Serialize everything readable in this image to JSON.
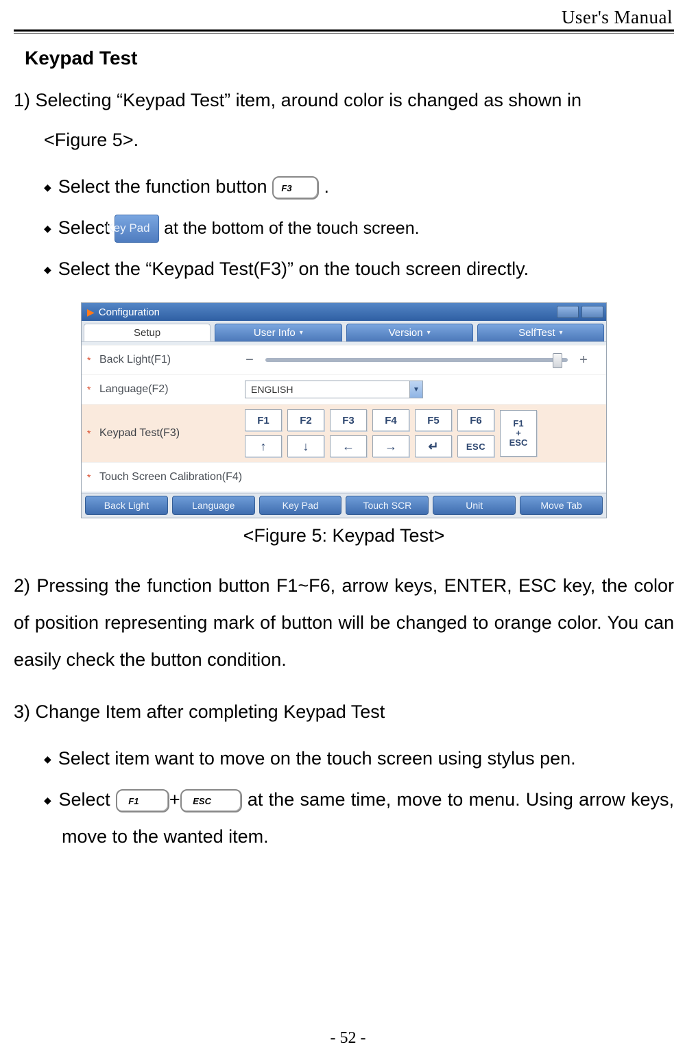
{
  "header": {
    "manual_title": "User's Manual"
  },
  "section": {
    "title": "Keypad Test"
  },
  "step1": {
    "intro_a": "1) Selecting “Keypad Test” item, around color is changed as shown in",
    "intro_b": "<Figure 5>.",
    "bullet1_pre": "Select the function button ",
    "bullet1_keycap": "F3",
    "bullet1_post": " .",
    "bullet2_pre": "Select ",
    "bullet2_softkey": "Key Pad",
    "bullet2_post": " at the bottom of the touch screen.",
    "bullet3": "Select the “Keypad Test(F3)” on the touch screen directly."
  },
  "device": {
    "title": "Configuration",
    "tabs": [
      "Setup",
      "User Info",
      "Version",
      "SelfTest"
    ],
    "rows": {
      "backlight": "Back Light(F1)",
      "language": "Language(F2)",
      "language_value": "ENGLISH",
      "keypad": "Keypad Test(F3)",
      "touchcal": "Touch Screen Calibration(F4)"
    },
    "fkeys_top": [
      "F1",
      "F2",
      "F3",
      "F4",
      "F5",
      "F6"
    ],
    "fkeys_bottom_arrows": [
      "↑",
      "↓",
      "←",
      "→",
      "↵"
    ],
    "fkeys_esc": "ESC",
    "fkeys_combo": "F1\n+\nESC",
    "softkeys": [
      "Back Light",
      "Language",
      "Key Pad",
      "Touch SCR",
      "Unit",
      "Move Tab"
    ]
  },
  "figure_caption": "<Figure 5: Keypad Test>",
  "step2": "2) Pressing the function button F1~F6, arrow keys, ENTER, ESC key, the color of position representing mark of button will be changed to orange color. You can easily check the button condition.",
  "step3": {
    "intro": "3) Change Item after completing Keypad Test",
    "bullet1": "Select item want to move on the touch screen using stylus pen.",
    "bullet2_pre": "Select ",
    "bullet2_key1": "F1",
    "bullet2_plus": "+",
    "bullet2_key2": "ESC",
    "bullet2_post": " at the same time, move to menu. Using arrow keys, move to the wanted item."
  },
  "footer": {
    "page": "- 52 -"
  }
}
